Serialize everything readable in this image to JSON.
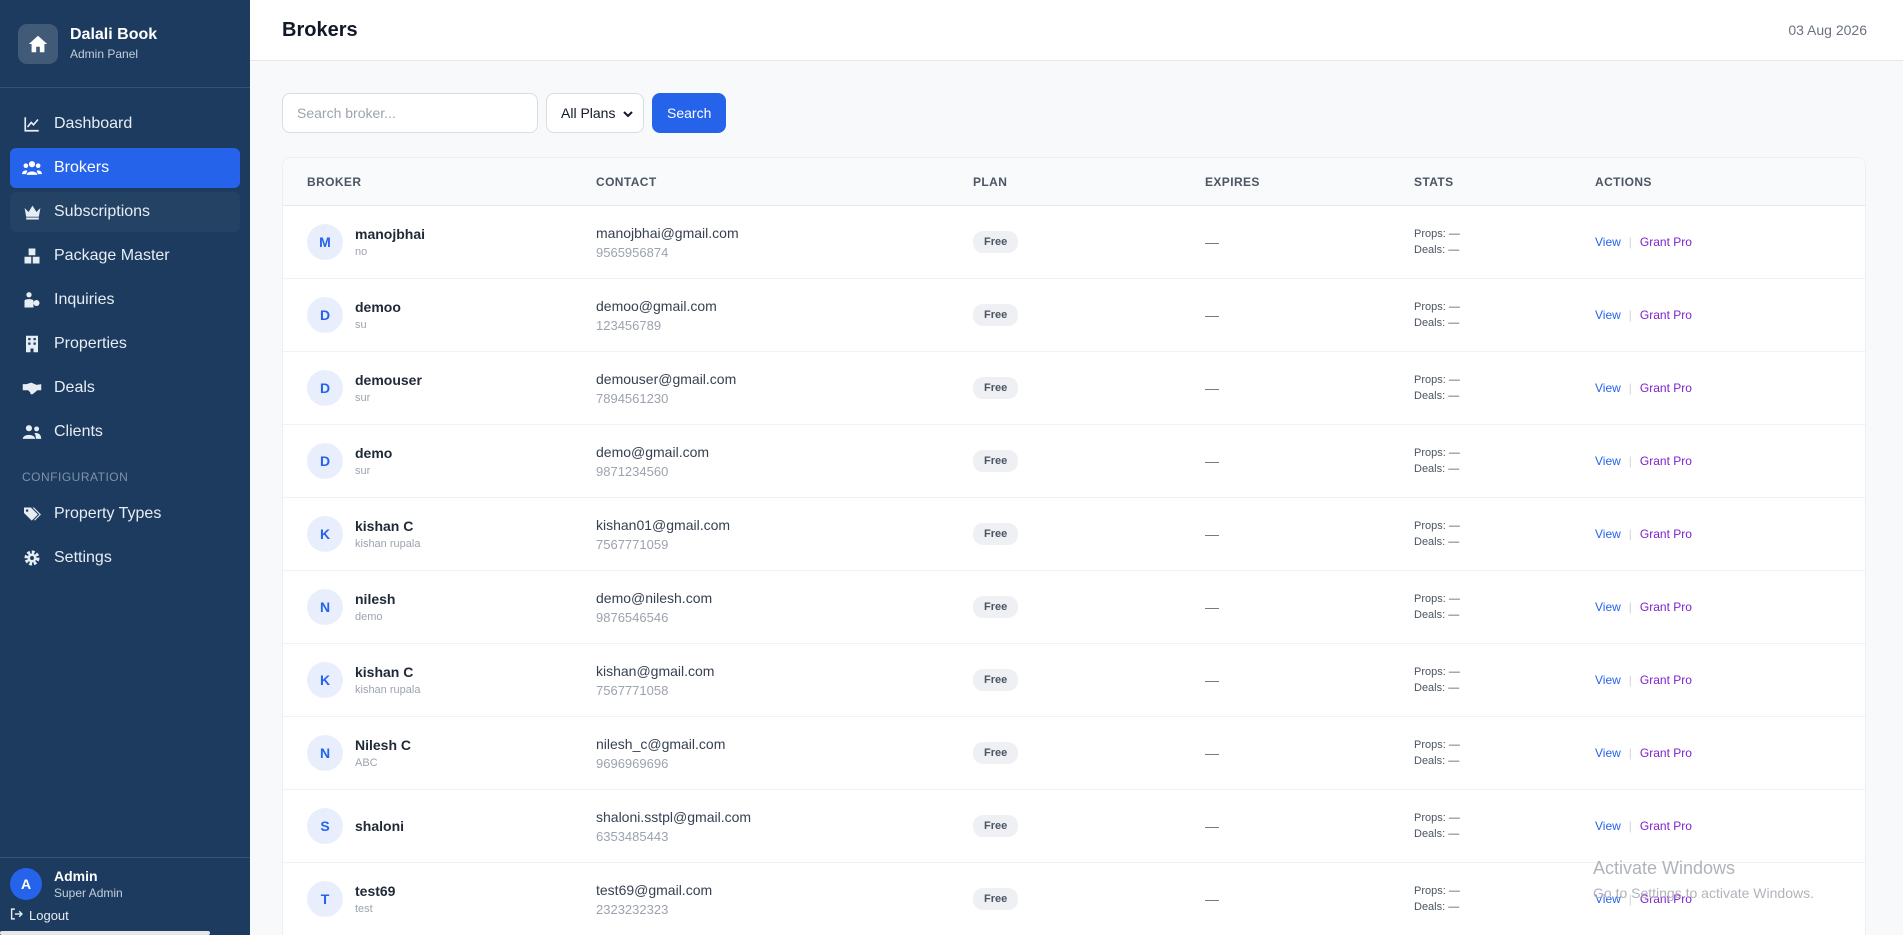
{
  "sidebar": {
    "brand_title": "Dalali Book",
    "brand_sub": "Admin Panel",
    "items": [
      {
        "label": "Dashboard",
        "icon": "chart-line-icon"
      },
      {
        "label": "Brokers",
        "icon": "users-icon",
        "active": true
      },
      {
        "label": "Subscriptions",
        "icon": "crown-icon"
      },
      {
        "label": "Package Master",
        "icon": "boxes-icon"
      },
      {
        "label": "Inquiries",
        "icon": "person-inquiry-icon"
      },
      {
        "label": "Properties",
        "icon": "building-icon"
      },
      {
        "label": "Deals",
        "icon": "handshake-icon"
      },
      {
        "label": "Clients",
        "icon": "users-icon"
      }
    ],
    "section_label": "CONFIGURATION",
    "config_items": [
      {
        "label": "Property Types",
        "icon": "tags-icon"
      },
      {
        "label": "Settings",
        "icon": "gear-icon"
      }
    ],
    "user": {
      "initial": "A",
      "name": "Admin",
      "role": "Super Admin"
    },
    "logout_label": "Logout"
  },
  "header": {
    "title": "Brokers",
    "date": "03 Aug 2026"
  },
  "toolbar": {
    "search_placeholder": "Search broker...",
    "plan_filter": "All Plans",
    "search_button": "Search"
  },
  "table": {
    "columns": [
      "BROKER",
      "CONTACT",
      "PLAN",
      "EXPIRES",
      "STATS",
      "ACTIONS"
    ],
    "rows": [
      {
        "initial": "M",
        "name": "manojbhai",
        "sub": "no",
        "email": "manojbhai@gmail.com",
        "phone": "9565956874",
        "plan": "Free",
        "expires": "—",
        "props": "Props: —",
        "deals": "Deals: —",
        "view": "View",
        "grant": "Grant Pro"
      },
      {
        "initial": "D",
        "name": "demoo",
        "sub": "su",
        "email": "demoo@gmail.com",
        "phone": "123456789",
        "plan": "Free",
        "expires": "—",
        "props": "Props: —",
        "deals": "Deals: —",
        "view": "View",
        "grant": "Grant Pro"
      },
      {
        "initial": "D",
        "name": "demouser",
        "sub": "sur",
        "email": "demouser@gmail.com",
        "phone": "7894561230",
        "plan": "Free",
        "expires": "—",
        "props": "Props: —",
        "deals": "Deals: —",
        "view": "View",
        "grant": "Grant Pro"
      },
      {
        "initial": "D",
        "name": "demo",
        "sub": "sur",
        "email": "demo@gmail.com",
        "phone": "9871234560",
        "plan": "Free",
        "expires": "—",
        "props": "Props: —",
        "deals": "Deals: —",
        "view": "View",
        "grant": "Grant Pro"
      },
      {
        "initial": "K",
        "name": "kishan C",
        "sub": "kishan rupala",
        "email": "kishan01@gmail.com",
        "phone": "7567771059",
        "plan": "Free",
        "expires": "—",
        "props": "Props: —",
        "deals": "Deals: —",
        "view": "View",
        "grant": "Grant Pro"
      },
      {
        "initial": "N",
        "name": "nilesh",
        "sub": "demo",
        "email": "demo@nilesh.com",
        "phone": "9876546546",
        "plan": "Free",
        "expires": "—",
        "props": "Props: —",
        "deals": "Deals: —",
        "view": "View",
        "grant": "Grant Pro"
      },
      {
        "initial": "K",
        "name": "kishan C",
        "sub": "kishan rupala",
        "email": "kishan@gmail.com",
        "phone": "7567771058",
        "plan": "Free",
        "expires": "—",
        "props": "Props: —",
        "deals": "Deals: —",
        "view": "View",
        "grant": "Grant Pro"
      },
      {
        "initial": "N",
        "name": "Nilesh C",
        "sub": "ABC",
        "email": "nilesh_c@gmail.com",
        "phone": "9696969696",
        "plan": "Free",
        "expires": "—",
        "props": "Props: —",
        "deals": "Deals: —",
        "view": "View",
        "grant": "Grant Pro"
      },
      {
        "initial": "S",
        "name": "shaloni",
        "sub": "",
        "email": "shaloni.sstpl@gmail.com",
        "phone": "6353485443",
        "plan": "Free",
        "expires": "—",
        "props": "Props: —",
        "deals": "Deals: —",
        "view": "View",
        "grant": "Grant Pro"
      },
      {
        "initial": "T",
        "name": "test69",
        "sub": "test",
        "email": "test69@gmail.com",
        "phone": "2323232323",
        "plan": "Free",
        "expires": "—",
        "props": "Props: —",
        "deals": "Deals: —",
        "view": "View",
        "grant": "Grant Pro"
      }
    ]
  },
  "watermark": {
    "line1": "Activate Windows",
    "line2": "Go to Settings to activate Windows."
  },
  "colors": {
    "sidebar": "#1c3b5e",
    "accent": "#2563eb",
    "grant": "#7e22ce"
  }
}
